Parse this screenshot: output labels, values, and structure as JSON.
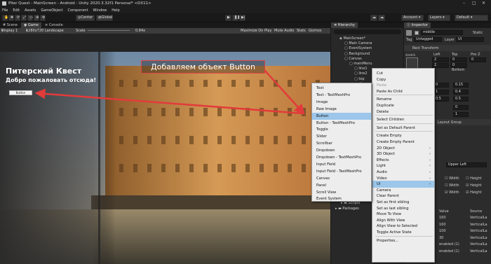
{
  "window": {
    "title": "Piter Quest - MainScreen - Android - Unity 2020.3.32f1 Personal* <DX11>"
  },
  "menubar": [
    "File",
    "Edit",
    "Assets",
    "GameObject",
    "Component",
    "Window",
    "Help"
  ],
  "toolbar": {
    "center_label": "Center",
    "global_label": "Global",
    "account_label": "Account",
    "layers_label": "Layers",
    "layout_label": "Default"
  },
  "tabs": {
    "scene": "Scene",
    "game": "Game",
    "console": "Console",
    "hierarchy": "Hierarchy",
    "inspector": "Inspector"
  },
  "game_toolbar": {
    "display": "Display 1",
    "resolution": "1280x720 Landscape",
    "scale_label": "Scale",
    "scale_value": "0.84x",
    "maximize": "Maximize On Play",
    "mute": "Mute Audio",
    "stats": "Stats",
    "gizmos": "Gizmos"
  },
  "game": {
    "title": "Питерский Квест",
    "subtitle": "Добро пожаловать отсюда!",
    "button_label": "Button",
    "annotation": "Добавляем объект Button"
  },
  "hierarchy": {
    "items": [
      {
        "label": "MainScreen*",
        "indent": 0
      },
      {
        "label": "Main Camera",
        "indent": 1
      },
      {
        "label": "EventSystem",
        "indent": 1
      },
      {
        "label": "Background",
        "indent": 1
      },
      {
        "label": "Canvas",
        "indent": 1
      },
      {
        "label": "mainMenu",
        "indent": 2
      },
      {
        "label": "line1",
        "indent": 3
      },
      {
        "label": "line2",
        "indent": 3
      },
      {
        "label": "top",
        "indent": 3
      },
      {
        "label": "gr",
        "indent": 4
      }
    ],
    "scripts_label": "Scripts",
    "packages_label": "Packages"
  },
  "inspector": {
    "object_name": "middle",
    "static_label": "Static",
    "tag_label": "Tag",
    "tag_value": "Untagged",
    "layer_label": "Layer",
    "layer_value": "UI",
    "rect_transform": "Rect Transform",
    "stretch": "stretch",
    "left_label": "Left",
    "top_label": "Top",
    "posz_label": "Pos Z",
    "left_value": "2",
    "top_value": "0",
    "posz_value": "0",
    "right_value": "2",
    "bottom_label": "Bottom",
    "bottom_value": "0",
    "anchor_x1": "0",
    "anchor_y1": "0.15",
    "anchor_x2": "1",
    "anchor_y2": "0.4",
    "pivot_x": "0.5",
    "pivot_y": "0.5",
    "rot_y": "0",
    "scale_y": "1",
    "layout_group": "Layout Group",
    "upper_left": "Upper Left",
    "width_label": "Width",
    "height_label": "Height",
    "table_headers": [
      "Value",
      "Source"
    ],
    "table_rows": [
      [
        "160",
        "VerticalLa"
      ],
      [
        "160",
        "VerticalLa"
      ],
      [
        "100",
        "VerticalLa"
      ],
      [
        "30",
        "VerticalLa"
      ],
      [
        "enabled (1)",
        "VerticalLa"
      ],
      [
        "enabled (1)",
        "VerticalLa"
      ]
    ]
  },
  "context_menu_main": {
    "items": [
      {
        "label": "Cut"
      },
      {
        "label": "Copy"
      },
      {
        "label": "Paste",
        "disabled": true
      },
      {
        "label": "Paste As Child"
      },
      {
        "sep": true
      },
      {
        "label": "Rename"
      },
      {
        "label": "Duplicate"
      },
      {
        "label": "Delete"
      },
      {
        "sep": true
      },
      {
        "label": "Select Children"
      },
      {
        "sep": true
      },
      {
        "label": "Set as Default Parent"
      },
      {
        "sep": true
      },
      {
        "label": "Create Empty"
      },
      {
        "label": "Create Empty Parent"
      },
      {
        "label": "2D Object",
        "sub": true
      },
      {
        "label": "3D Object",
        "sub": true
      },
      {
        "label": "Effects",
        "sub": true
      },
      {
        "label": "Light",
        "sub": true
      },
      {
        "label": "Audio",
        "sub": true
      },
      {
        "label": "Video",
        "sub": true
      },
      {
        "label": "UI",
        "sub": true,
        "highlight": true
      },
      {
        "label": "Camera"
      },
      {
        "label": "Clear Parent"
      },
      {
        "label": "Set as first sibling"
      },
      {
        "label": "Set as last sibling"
      },
      {
        "label": "Move To View"
      },
      {
        "label": "Align With View"
      },
      {
        "label": "Align View to Selected"
      },
      {
        "label": "Toggle Active State"
      },
      {
        "sep": true
      },
      {
        "label": "Properties..."
      }
    ]
  },
  "context_menu_ui": {
    "items": [
      {
        "label": "Text"
      },
      {
        "label": "Text - TextMeshPro"
      },
      {
        "label": "Image"
      },
      {
        "label": "Raw Image"
      },
      {
        "label": "Button",
        "highlight": true
      },
      {
        "label": "Button - TextMeshPro"
      },
      {
        "label": "Toggle"
      },
      {
        "label": "Slider"
      },
      {
        "label": "Scrollbar"
      },
      {
        "label": "Dropdown"
      },
      {
        "label": "Dropdown - TextMeshPro"
      },
      {
        "label": "Input Field"
      },
      {
        "label": "Input Field - TextMeshPro"
      },
      {
        "label": "Canvas"
      },
      {
        "label": "Panel"
      },
      {
        "label": "Scroll View"
      },
      {
        "label": "Event System"
      }
    ]
  }
}
